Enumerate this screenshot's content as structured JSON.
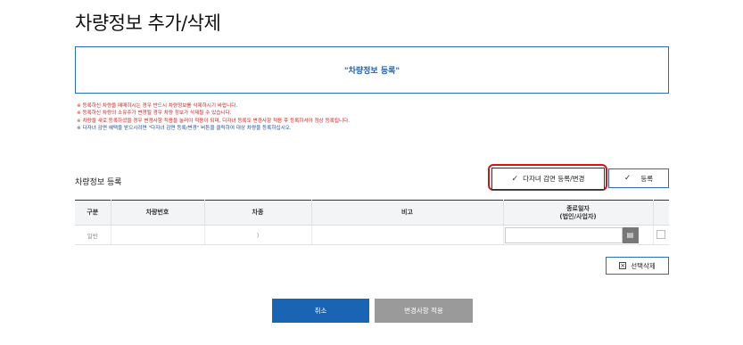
{
  "page": {
    "title": "차량정보 추가/삭제"
  },
  "info_box": {
    "text": "\"차량정보 등록\""
  },
  "notes": [
    {
      "text": "※ 등록하신 차량을 매매하시는 경우 반드시 차량정보를 삭제하시기 바랍니다.",
      "color": "red"
    },
    {
      "text": "※ 등록하신 차량의 소유주가 변경될 경우 차량 정보가 삭제될 수 있습니다.",
      "color": "red"
    },
    {
      "text": "※ 차량을 새로 등록하셨을 경우 변경사항 적용을 눌러야 적용이 되며, 다자녀 등록도 변경사항 적용 후 등록하셔야 정상 등록됩니다.",
      "color": "red"
    },
    {
      "text": "※ 다자녀 감면 혜택을 받으시려면 \"다자녀 감면 등록/변경\" 버튼을 클릭하여 대상 차량을 등록하십시오.",
      "color": "blue"
    }
  ],
  "section": {
    "title": "차량정보 등록"
  },
  "buttons": {
    "discount": "다자녀 감면 등록/변경",
    "register": "등록",
    "delete": "선택삭제",
    "cancel": "취소",
    "apply": "변경사항 적용"
  },
  "table": {
    "headers": {
      "type": "구분",
      "plate": "차량번호",
      "model": "차종",
      "note": "비고",
      "end_date_line1": "종료일자",
      "end_date_line2": "(법인/사업자)"
    },
    "row": {
      "type": "일반",
      "plate": "",
      "model": ")",
      "note": "",
      "end_date": ""
    }
  },
  "colors": {
    "accent": "#1a64b4",
    "border_blue": "#2b6cb8",
    "highlight": "#e01010",
    "disabled": "#9a9a9a"
  },
  "icons": [
    "check-icon",
    "calendar-icon",
    "x-box-icon"
  ]
}
